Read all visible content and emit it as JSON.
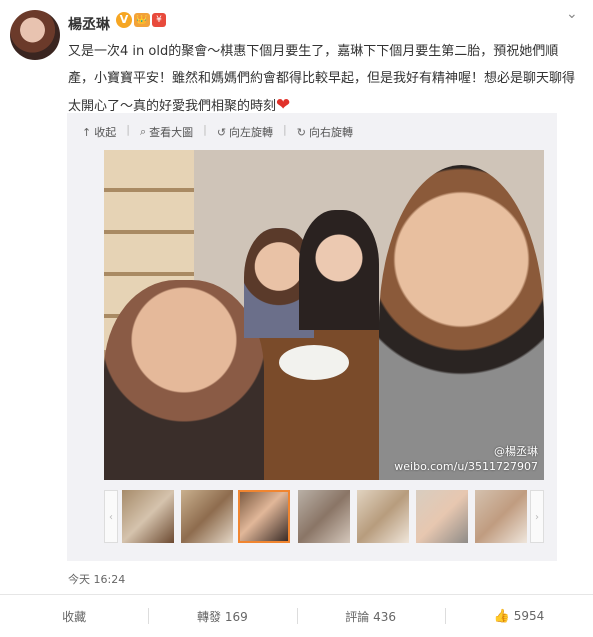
{
  "user": {
    "name": "楊丞琳",
    "badges": [
      "V",
      "👑",
      "¥"
    ]
  },
  "post": {
    "text": "又是一次4 in old的聚會〜棋惠下個月要生了，嘉琳下下個月要生第二胎，預祝她們順產，小寶寶平安！雖然和媽媽們約會都得比較早起，但是我好有精神喔！想必是聊天聊得太開心了〜真的好愛我們相聚的時刻",
    "emoji": "❤"
  },
  "media": {
    "toolbar": {
      "collapse": "收起",
      "view_large": "查看大圖",
      "rotate_left": "向左旋轉",
      "rotate_right": "向右旋轉"
    },
    "watermark_user": "@楊丞琳",
    "watermark_url": "weibo.com/u/3511727907",
    "thumbnail_count": 7,
    "active_thumbnail": 3
  },
  "timestamp": "今天 16:24",
  "footer": {
    "favorite": "收藏",
    "repost": "轉發 169",
    "comment": "評論 436",
    "like": "5954"
  },
  "colors": {
    "accent": "#f08530",
    "heart": "#e0312a",
    "verified": "#f6a623"
  }
}
